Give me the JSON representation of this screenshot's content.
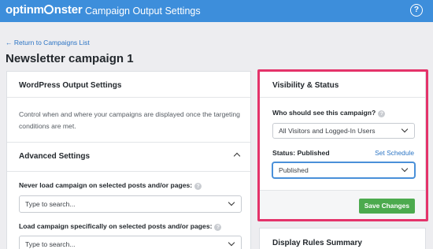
{
  "header": {
    "logo_before": "optinm",
    "logo_after": "nster",
    "title": "Campaign Output Settings",
    "help_icon": "?"
  },
  "nav": {
    "back_link": "← Return to Campaigns List"
  },
  "page": {
    "title": "Newsletter campaign 1"
  },
  "output_panel": {
    "title": "WordPress Output Settings",
    "help_text": "Control when and where your campaigns are displayed once the targeting conditions are met."
  },
  "advanced": {
    "title": "Advanced Settings",
    "never_load_label": "Never load campaign on selected posts and/or pages:",
    "never_load_placeholder": "Type to search...",
    "load_specific_label": "Load campaign specifically on selected posts and/or pages:",
    "load_specific_placeholder": "Type to search..."
  },
  "visibility_panel": {
    "title": "Visibility & Status",
    "who_label": "Who should see this campaign?",
    "who_value": "All Visitors and Logged-In Users",
    "status_label": "Status: Published",
    "set_schedule": "Set Schedule",
    "status_value": "Published",
    "save_button": "Save Changes"
  },
  "summary_panel": {
    "title": "Display Rules Summary"
  },
  "colors": {
    "brand_blue": "#3d8edb",
    "highlight": "#e4336a",
    "save_green": "#4caa4e",
    "link": "#2b74c4"
  }
}
